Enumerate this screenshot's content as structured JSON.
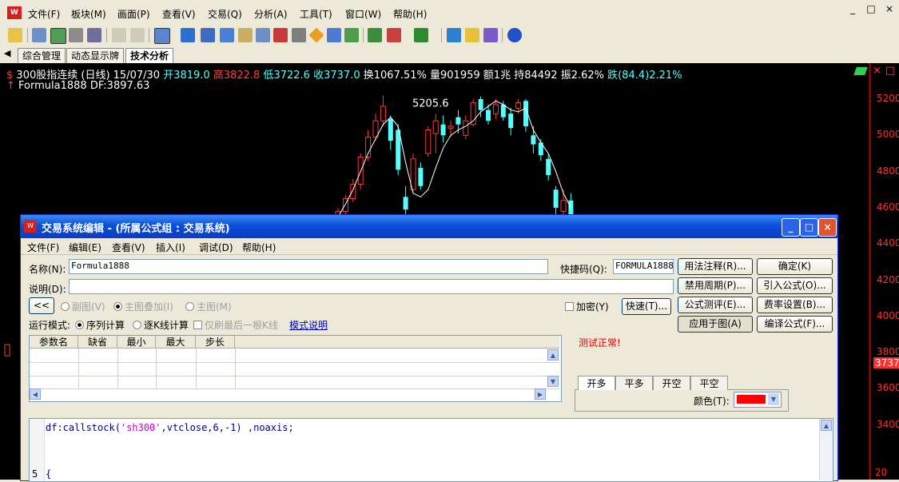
{
  "app": {
    "menus": [
      "文件(F)",
      "板块(M)",
      "画面(P)",
      "查看(V)",
      "交易(Q)",
      "分析(A)",
      "工具(T)",
      "窗口(W)",
      "帮助(H)"
    ],
    "window_controls": [
      "_",
      "□",
      "×"
    ]
  },
  "tabs": [
    "综合管理",
    "动态显示牌",
    "技术分析"
  ],
  "tab_nav": "◀",
  "quote": {
    "name": "300股指连续 (日线)",
    "date": "15/07/30",
    "open": "开3819.0",
    "high": "高3822.8",
    "low": "低3722.6",
    "close": "收3737.0",
    "turnover": "换1067.51%",
    "volume": "量901959",
    "amount": "额1兆",
    "hold": "持84492",
    "amplitude": "振2.62%",
    "change": "跌(84.4)2.21%",
    "formula": "Formula1888 DF:3897.63",
    "peak_label": "5205.6",
    "current_price_tag": "3737"
  },
  "yaxis": {
    "ticks": [
      "5200",
      "5000",
      "4800",
      "4600",
      "4400",
      "4200",
      "4000",
      "3800",
      "3600",
      "3400"
    ],
    "bottom_label": "20"
  },
  "colors": {
    "up": "#ff3a3a",
    "down": "#54ffff",
    "axis": "#c00000"
  },
  "chart_data": {
    "type": "candlestick",
    "ylim": [
      3300,
      5300
    ],
    "annotations": [
      "5205.6"
    ],
    "candles": [
      {
        "o": 4470,
        "c": 4580,
        "h": 4600,
        "l": 4450
      },
      {
        "o": 4580,
        "c": 4650,
        "h": 4670,
        "l": 4560
      },
      {
        "o": 4650,
        "c": 4730,
        "h": 4760,
        "l": 4630
      },
      {
        "o": 4730,
        "c": 4880,
        "h": 4900,
        "l": 4700
      },
      {
        "o": 4880,
        "c": 4990,
        "h": 5030,
        "l": 4860
      },
      {
        "o": 4990,
        "c": 5080,
        "h": 5120,
        "l": 4970
      },
      {
        "o": 5080,
        "c": 5160,
        "h": 5220,
        "l": 5050
      },
      {
        "o": 5090,
        "c": 4970,
        "h": 5110,
        "l": 4920
      },
      {
        "o": 5030,
        "c": 4810,
        "h": 5060,
        "l": 4780
      },
      {
        "o": 4660,
        "c": 4590,
        "h": 4720,
        "l": 4560
      },
      {
        "o": 4700,
        "c": 4870,
        "h": 4900,
        "l": 4680
      },
      {
        "o": 4820,
        "c": 4720,
        "h": 4850,
        "l": 4700
      },
      {
        "o": 4900,
        "c": 5030,
        "h": 5050,
        "l": 4880
      },
      {
        "o": 5010,
        "c": 5080,
        "h": 5120,
        "l": 4900
      },
      {
        "o": 5060,
        "c": 5000,
        "h": 5110,
        "l": 4960
      },
      {
        "o": 5040,
        "c": 5050,
        "h": 5080,
        "l": 4990
      },
      {
        "o": 5100,
        "c": 5060,
        "h": 5140,
        "l": 5010
      },
      {
        "o": 5000,
        "c": 5080,
        "h": 5110,
        "l": 4980
      },
      {
        "o": 5060,
        "c": 5180,
        "h": 5200,
        "l": 5050
      },
      {
        "o": 5200,
        "c": 5140,
        "h": 5215,
        "l": 5100
      },
      {
        "o": 5140,
        "c": 5080,
        "h": 5170,
        "l": 5060
      },
      {
        "o": 5120,
        "c": 5170,
        "h": 5200,
        "l": 5090
      },
      {
        "o": 5170,
        "c": 5100,
        "h": 5190,
        "l": 5080
      },
      {
        "o": 5120,
        "c": 5040,
        "h": 5150,
        "l": 5000
      },
      {
        "o": 5150,
        "c": 5180,
        "h": 5200,
        "l": 5120
      },
      {
        "o": 5190,
        "c": 5050,
        "h": 5200,
        "l": 5020
      },
      {
        "o": 5000,
        "c": 4950,
        "h": 5050,
        "l": 4900
      },
      {
        "o": 4960,
        "c": 4890,
        "h": 4980,
        "l": 4860
      },
      {
        "o": 4870,
        "c": 4780,
        "h": 4900,
        "l": 4750
      },
      {
        "o": 4700,
        "c": 4600,
        "h": 4720,
        "l": 4560
      },
      {
        "o": 4580,
        "c": 4640,
        "h": 4700,
        "l": 4550
      },
      {
        "o": 4640,
        "c": 4560,
        "h": 4680,
        "l": 4520
      }
    ],
    "line": [
      4550,
      4620,
      4700,
      4800,
      4900,
      4980,
      5060,
      5100,
      5050,
      4850,
      4680,
      4660,
      4700,
      4820,
      4930,
      5000,
      5030,
      5050,
      5080,
      5130,
      5160,
      5190,
      5170,
      5140,
      5130,
      5150,
      5030,
      4960,
      4900,
      4800,
      4680,
      4600
    ]
  },
  "dialog": {
    "title": "交易系统编辑 - (所属公式组 : 交易系统)",
    "menus": [
      "文件(F)",
      "编辑(E)",
      "查看(V)",
      "插入(I)",
      "调试(D)",
      "帮助(H)"
    ],
    "name_label": "名称(N):",
    "name_value": "Formula1888",
    "shortcut_label": "快捷码(Q):",
    "shortcut_value": "FORMULA1888",
    "desc_label": "说明(D):",
    "desc_value": "",
    "collapse_btn": "<<",
    "display_options": [
      "副图(V)",
      "主图叠加(I)",
      "主图(M)"
    ],
    "encrypt": "加密(Y)",
    "quick_btn": "快速(T)...",
    "run_mode_label": "运行模式:",
    "run_options": [
      "序列计算",
      "逐K线计算"
    ],
    "last_k_option": "仅刷最后一根K线",
    "mode_help": "模式说明",
    "buttons_col1": [
      "用法注释(R)...",
      "禁用周期(P)...",
      "公式测评(E)...",
      "应用于图(A)"
    ],
    "buttons_col2": [
      "确定(K)",
      "引入公式(O)...",
      "费率设置(B)...",
      "编译公式(F)..."
    ],
    "status": "测试正常!",
    "param_headers": [
      "参数名",
      "缺省",
      "最小",
      "最大",
      "步长"
    ],
    "signal_tabs": [
      "开多",
      "平多",
      "开空",
      "平空"
    ],
    "color_label": "颜色(T):",
    "code_line1_a": "df:callstock(",
    "code_line1_str": "'sh300'",
    "code_line1_b": ",vtclose,6,-1) ,noaxis;",
    "code_line_num": "5",
    "code_line2": "{"
  }
}
